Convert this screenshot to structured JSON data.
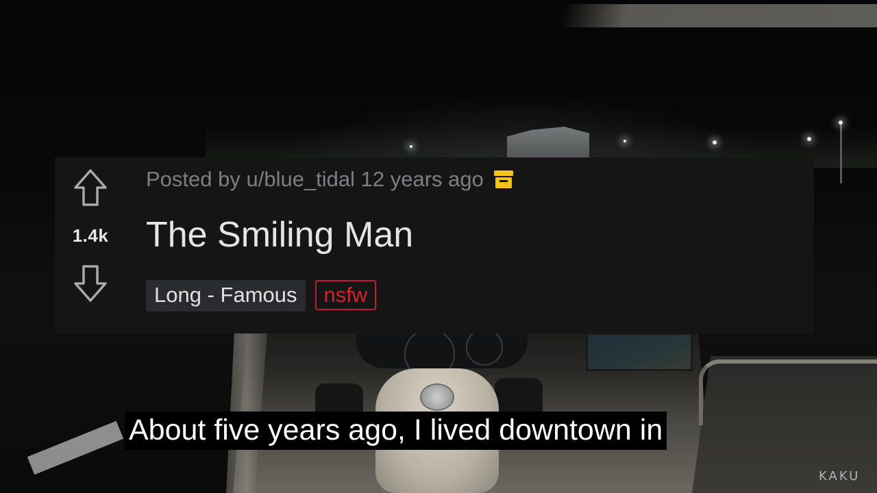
{
  "post": {
    "score": "1.4k",
    "posted_by": "Posted by u/blue_tidal 12 years ago",
    "title": "The Smiling Man",
    "flair": "Long - Famous",
    "nsfw_tag": "nsfw"
  },
  "subtitle": "About five years ago, I lived downtown in",
  "watermark": "KAKU",
  "colors": {
    "card_bg": "#151516",
    "archive_icon": "#f6c21d",
    "nsfw": "#d8202f",
    "meta_text": "#7c7f83"
  },
  "icons": [
    "upvote-arrow-icon",
    "downvote-arrow-icon",
    "archive-box-icon"
  ]
}
